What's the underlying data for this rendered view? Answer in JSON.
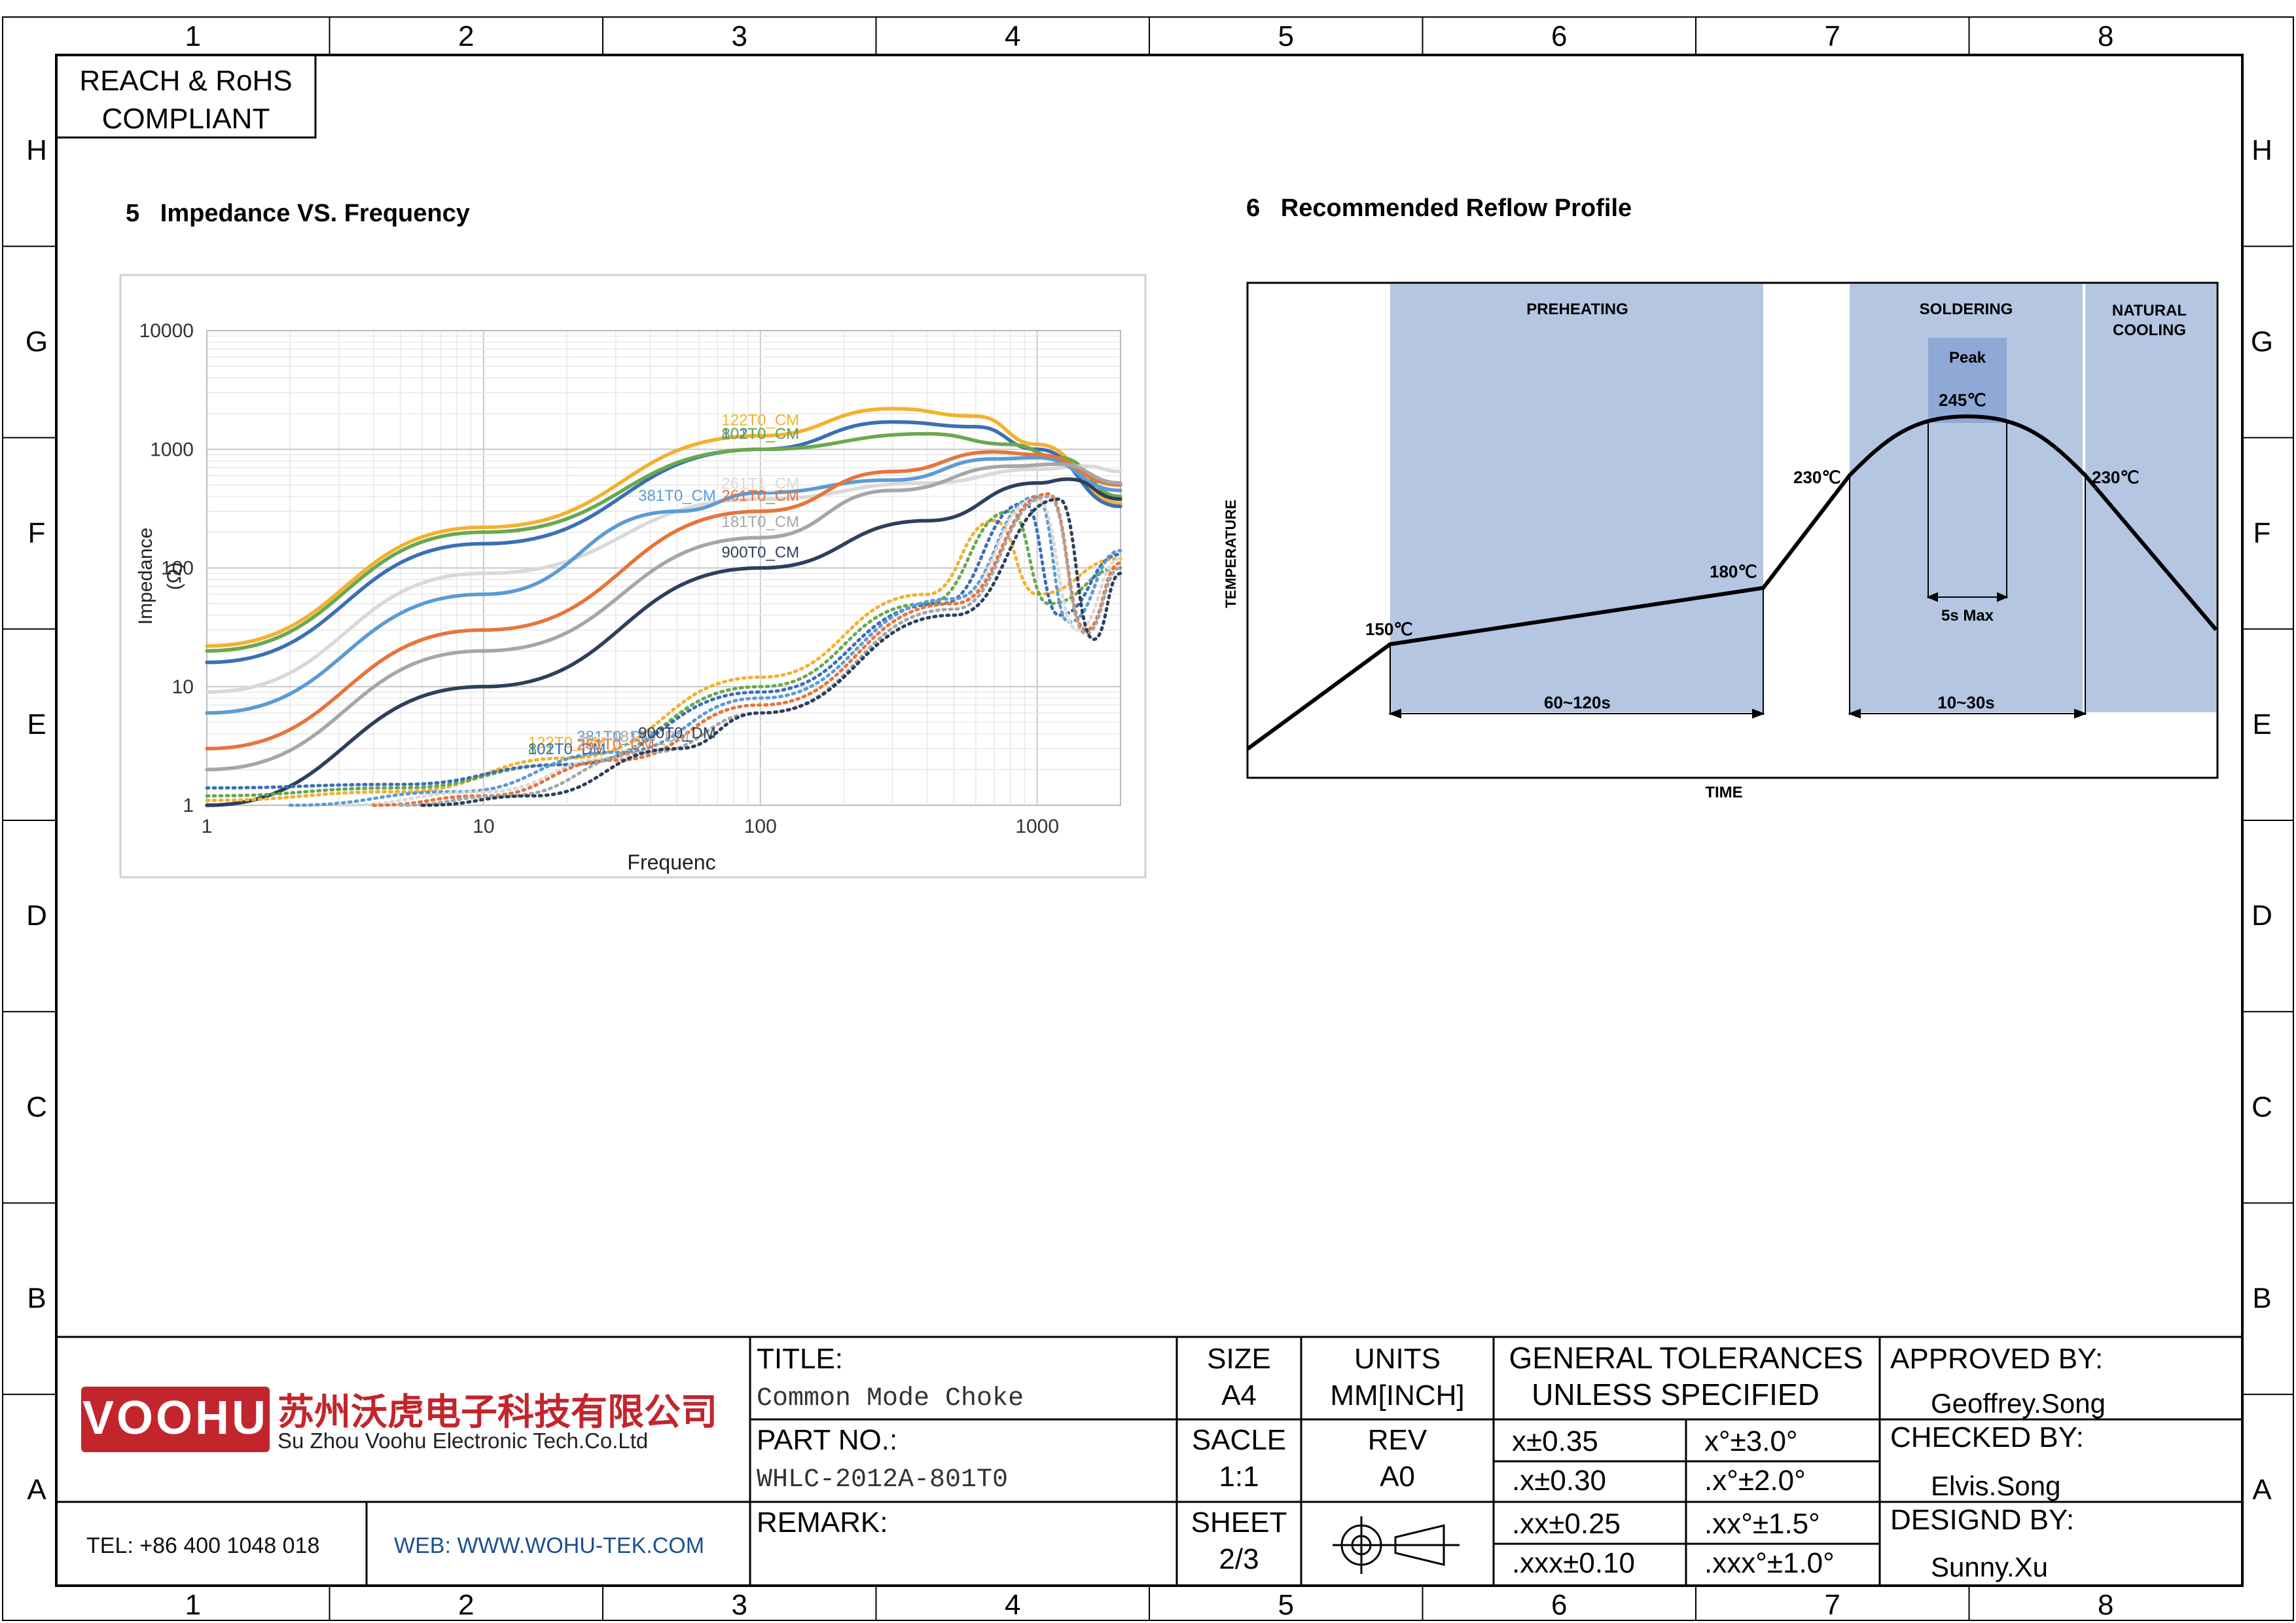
{
  "drawing": {
    "column_labels": [
      "1",
      "2",
      "3",
      "4",
      "5",
      "6",
      "7",
      "8"
    ],
    "row_labels": [
      "H",
      "G",
      "F",
      "E",
      "D",
      "C",
      "B",
      "A"
    ],
    "compliance": [
      "REACH & RoHS",
      "COMPLIANT"
    ]
  },
  "section5": {
    "title": "5   Impedance VS. Frequency"
  },
  "section6": {
    "title": "6   Recommended Reflow Profile"
  },
  "chart_data": [
    {
      "type": "line",
      "xlabel": "Frequenc",
      "ylabel_lines": [
        "Impedance",
        "(Ω)"
      ],
      "x_scale": "log",
      "y_scale": "log",
      "xlim": [
        1,
        2000
      ],
      "ylim": [
        1,
        10000
      ],
      "x_ticks": [
        1,
        10,
        100,
        1000
      ],
      "x_tick_labels": [
        "1",
        "10",
        "100",
        "1000"
      ],
      "y_ticks": [
        1,
        10,
        100,
        1000,
        10000
      ],
      "y_tick_labels": [
        "1",
        "10",
        "100",
        "1000",
        "10000"
      ],
      "grid": true,
      "series": [
        {
          "name": "122T0_CM",
          "color": "#f2b12e",
          "style": "solid",
          "x": [
            1,
            10,
            100,
            300,
            600,
            1000,
            2000
          ],
          "y": [
            22,
            220,
            1300,
            2200,
            1900,
            1100,
            350
          ]
        },
        {
          "name": "102T0_CM",
          "color": "#3a6fb5",
          "style": "solid",
          "x": [
            1,
            10,
            100,
            300,
            600,
            1000,
            2000
          ],
          "y": [
            16,
            160,
            1000,
            1700,
            1550,
            1000,
            330
          ]
        },
        {
          "name": "801T0_CM",
          "color": "#6aa84f",
          "style": "solid",
          "x": [
            1,
            10,
            100,
            400,
            800,
            1200,
            2000
          ],
          "y": [
            20,
            200,
            1000,
            1350,
            1100,
            850,
            400
          ]
        },
        {
          "name": "261T1_CM",
          "color": "#d9d9d9",
          "style": "solid",
          "x": [
            1,
            10,
            100,
            400,
            1000,
            1500,
            2000
          ],
          "y": [
            9,
            90,
            380,
            520,
            680,
            720,
            650
          ]
        },
        {
          "name": "381T0_CM",
          "color": "#5b9bd5",
          "style": "solid",
          "x": [
            1,
            10,
            50,
            100,
            300,
            700,
            1000,
            2000
          ],
          "y": [
            6,
            60,
            300,
            430,
            550,
            830,
            850,
            450
          ]
        },
        {
          "name": "261T0_CM",
          "color": "#e8743b",
          "style": "solid",
          "x": [
            1,
            10,
            100,
            300,
            700,
            1000,
            2000
          ],
          "y": [
            3,
            30,
            300,
            650,
            950,
            900,
            500
          ]
        },
        {
          "name": "181T0_CM",
          "color": "#a6a6a6",
          "style": "solid",
          "x": [
            1,
            10,
            100,
            300,
            800,
            1200,
            2000
          ],
          "y": [
            2,
            20,
            180,
            450,
            720,
            750,
            520
          ]
        },
        {
          "name": "900T0_CM",
          "color": "#2e3f5c",
          "style": "solid",
          "x": [
            1,
            10,
            100,
            400,
            1000,
            1300,
            2000
          ],
          "y": [
            1,
            10,
            100,
            250,
            520,
            560,
            380
          ]
        },
        {
          "name": "122T0_DM",
          "color": "#f2b12e",
          "style": "dotted",
          "x": [
            1,
            5,
            20,
            100,
            400,
            700,
            1000,
            2000
          ],
          "y": [
            1.1,
            1.3,
            2.5,
            12,
            60,
            250,
            60,
            120
          ]
        },
        {
          "name": "801T0_DM",
          "color": "#6aa84f",
          "style": "dotted",
          "x": [
            1,
            5,
            20,
            100,
            400,
            800,
            1100,
            2000
          ],
          "y": [
            1.2,
            1.4,
            2.2,
            10,
            50,
            300,
            50,
            100
          ]
        },
        {
          "name": "102T0_DM",
          "color": "#3a6fb5",
          "style": "dotted",
          "x": [
            1,
            5,
            20,
            100,
            450,
            900,
            1200,
            2000
          ],
          "y": [
            1.4,
            1.5,
            2.2,
            9,
            50,
            350,
            40,
            130
          ]
        },
        {
          "name": "381T0_DM",
          "color": "#5b9bd5",
          "style": "dotted",
          "x": [
            2,
            8,
            30,
            100,
            500,
            1000,
            1300,
            2000
          ],
          "y": [
            1,
            1.3,
            2.8,
            8,
            55,
            400,
            35,
            140
          ]
        },
        {
          "name": "261T1_DM",
          "color": "#d9d9d9",
          "style": "dotted",
          "x": [
            3,
            10,
            30,
            100,
            500,
            1000,
            1400,
            2000
          ],
          "y": [
            1,
            1.3,
            2.5,
            7,
            50,
            380,
            30,
            120
          ]
        },
        {
          "name": "261T0_DM",
          "color": "#e8743b",
          "style": "dotted",
          "x": [
            4,
            10,
            30,
            100,
            500,
            1100,
            1500,
            2000
          ],
          "y": [
            1,
            1.2,
            2.4,
            7,
            50,
            420,
            30,
            110
          ]
        },
        {
          "name": "181T0_DM",
          "color": "#a6a6a6",
          "style": "dotted",
          "x": [
            5,
            12,
            40,
            100,
            500,
            1100,
            1500,
            2000
          ],
          "y": [
            1,
            1.2,
            2.8,
            6,
            45,
            400,
            28,
            100
          ]
        },
        {
          "name": "900T0_DM",
          "color": "#2e3f5c",
          "style": "dotted",
          "x": [
            6,
            15,
            50,
            100,
            500,
            1200,
            1600,
            2000
          ],
          "y": [
            1,
            1.2,
            3,
            6,
            40,
            380,
            25,
            90
          ]
        }
      ]
    },
    {
      "type": "line",
      "xlabel": "TIME",
      "ylabel": "TEMPERATURE",
      "profile_points": [
        {
          "label": "",
          "t": 0,
          "temp": 0
        },
        {
          "label": "150℃",
          "t": 1,
          "temp": 1
        },
        {
          "label": "180℃",
          "t": 4,
          "temp": 1.4
        },
        {
          "label": "230℃",
          "t": 4.8,
          "temp": 2.5
        },
        {
          "label": "245℃",
          "t": 5.9,
          "temp": 3.05
        },
        {
          "label": "230℃",
          "t": 7.0,
          "temp": 2.5
        },
        {
          "label": "",
          "t": 8.6,
          "temp": 1.2
        }
      ],
      "zones": [
        {
          "label": "PREHEATING",
          "color": "#b4c6e2"
        },
        {
          "label": "SOLDERING",
          "color": "#b4c6e2"
        },
        {
          "label": "Peak",
          "color": "#8ea9d6"
        },
        {
          "label": "NATURAL COOLING",
          "color": "#b4c6e2"
        }
      ],
      "durations": [
        "60~120s",
        "10~30s",
        "5s Max"
      ]
    }
  ],
  "title_block": {
    "company_logo": "VOOHU",
    "company_cn": "苏州沃虎电子科技有限公司",
    "company_en": "Su Zhou Voohu Electronic Tech.Co.Ltd",
    "tel": "TEL: +86 400 1048 018",
    "web": "WEB: WWW.WOHU-TEK.COM",
    "title_label": "TITLE:",
    "title_value": "Common Mode Choke",
    "part_label": "PART NO.:",
    "part_value": "WHLC-2012A-801T0",
    "remark_label": "REMARK:",
    "size_label": "SIZE",
    "size_value": "A4",
    "units_label": "UNITS",
    "units_value": "MM[INCH]",
    "scale_label": "SACLE",
    "scale_value": "1:1",
    "rev_label": "REV",
    "rev_value": "A0",
    "sheet_label": "SHEET",
    "sheet_value": "2/3",
    "tol_header_1": "GENERAL TOLERANCES",
    "tol_header_2": "UNLESS SPECIFIED",
    "tolerances": [
      [
        "x±0.35",
        "x°±3.0°"
      ],
      [
        ".x±0.30",
        ".x°±2.0°"
      ],
      [
        ".xx±0.25",
        ".xx°±1.5°"
      ],
      [
        ".xxx±0.10",
        ".xxx°±1.0°"
      ]
    ],
    "approved_label": "APPROVED BY:",
    "approved_value": "Geoffrey.Song",
    "checked_label": "CHECKED BY:",
    "checked_value": "Elvis.Song",
    "designed_label": "DESIGND BY:",
    "designed_value": "Sunny.Xu"
  }
}
